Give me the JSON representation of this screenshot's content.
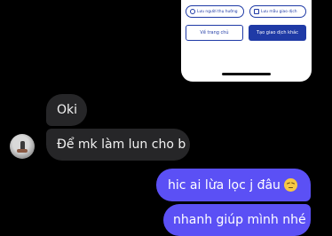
{
  "shared_screenshot": {
    "buttons": {
      "save_recipient": "Lưu người thụ hưởng",
      "save_template": "Lưu mẫu giao dịch",
      "back_home": "Về trang chủ",
      "new_transaction": "Tạo giao dịch khác"
    }
  },
  "messages": [
    {
      "side": "in",
      "text": "Oki"
    },
    {
      "side": "in",
      "text": "Để mk làm lun cho b"
    },
    {
      "side": "out",
      "text": "hic ai lừa lọc j đâu",
      "emoji": "disappointed-face"
    },
    {
      "side": "out",
      "text": "nhanh giúp mình nhé"
    }
  ],
  "colors": {
    "background": "#000000",
    "incoming_bubble": "#262628",
    "outgoing_bubble": "#5b50f5",
    "bank_primary": "#1f3aa6"
  }
}
